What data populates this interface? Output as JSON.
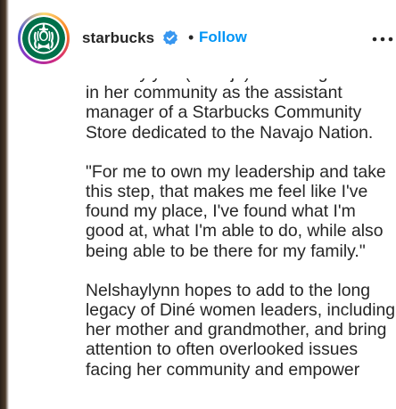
{
  "post_header": {
    "username": "starbucks",
    "separator": "•",
    "follow_label": "Follow",
    "colors": {
      "follow": "#0095f6",
      "verified_badge": "#3897f0",
      "brand_green": "#00704a"
    },
    "icons": {
      "verified": "verified-badge-icon",
      "more": "more-options-icon",
      "avatar": "starbucks-siren-logo"
    }
  },
  "caption": {
    "paragraph_1": [
      "Nelshaylynn (Navajo) is serving",
      "in her community as the assistant",
      "manager of a Starbucks Community",
      "Store dedicated to the Navajo Nation."
    ],
    "paragraph_2": [
      "\"For me to own my leadership and take",
      "this step, that makes me feel like I've",
      "found my place, I've found what I'm",
      "good at, what I'm able to do, while also",
      "being able to be there for my family.\""
    ],
    "paragraph_3": [
      "Nelshaylynn hopes to add to the long",
      "legacy of Diné women leaders, including",
      "her mother and grandmother, and bring",
      "attention to often overlooked issues",
      "facing her community and empower"
    ]
  }
}
